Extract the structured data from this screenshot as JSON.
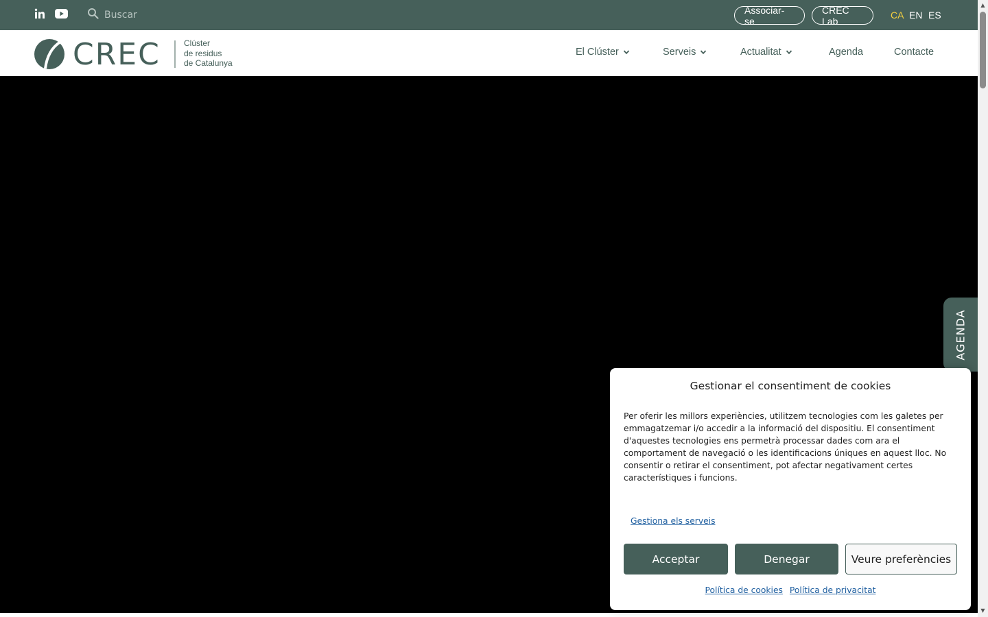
{
  "colors": {
    "brand": "#46605a",
    "active_lang": "#f4d03f",
    "link": "#1f5fa0",
    "hero": "#000000"
  },
  "topbar": {
    "social": [
      {
        "icon": "linkedin-icon"
      },
      {
        "icon": "youtube-icon"
      }
    ],
    "search": {
      "placeholder": "Buscar",
      "icon": "search-icon"
    },
    "buttons": {
      "associar": "Associar-se",
      "lab": "CREC Lab"
    },
    "languages": [
      {
        "code": "CA",
        "active": true
      },
      {
        "code": "EN",
        "active": false
      },
      {
        "code": "ES",
        "active": false
      }
    ]
  },
  "header": {
    "logo": {
      "wordmark": "CREC",
      "tagline_1": "Clúster",
      "tagline_2": "de residus",
      "tagline_3": "de Catalunya"
    },
    "nav": [
      {
        "label": "El Clúster",
        "dropdown": true
      },
      {
        "label": "Serveis",
        "dropdown": true
      },
      {
        "label": "Actualitat",
        "dropdown": true
      },
      {
        "label": "Agenda",
        "dropdown": false
      },
      {
        "label": "Contacte",
        "dropdown": false
      }
    ]
  },
  "agenda_tab": {
    "label": "AGENDA"
  },
  "cookie": {
    "title": "Gestionar el consentiment de cookies",
    "body": "Per oferir les millors experiències, utilitzem tecnologies com les galetes per emmagatzemar i/o accedir a la informació del dispositiu. El consentiment d'aquestes tecnologies ens permetrà processar dades com ara el comportament de navegació o les identificacions úniques en aquest lloc. No consentir o retirar el consentiment, pot afectar negativament certes característiques i funcions.",
    "manage": "Gestiona els serveis",
    "accept": "Acceptar",
    "deny": "Denegar",
    "prefs": "Veure preferències",
    "cookie_policy": "Política de cookies",
    "privacy_policy": "Política de privacitat"
  }
}
